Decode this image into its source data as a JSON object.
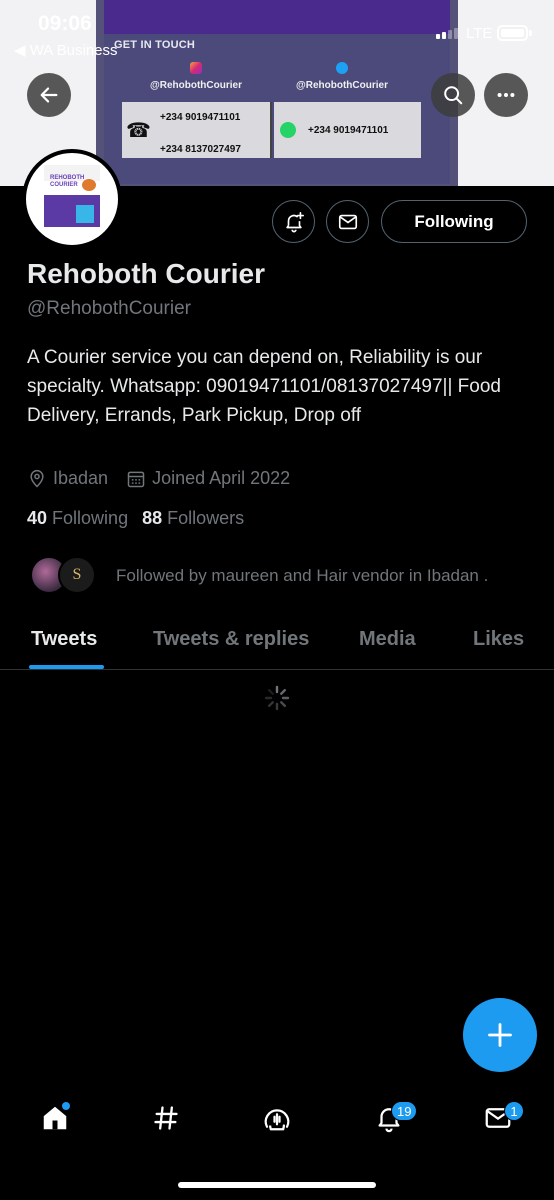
{
  "status_bar": {
    "time": "09:06",
    "back_app": "◀ WA Business",
    "network": "LTE"
  },
  "banner": {
    "heading": "GET IN TOUCH",
    "instagram_handle": "@RehobothCourier",
    "twitter_handle": "@RehobothCourier",
    "phone_1": "+234 9019471101",
    "phone_2": "+234 8137027497",
    "whatsapp_phone": "+234 9019471101"
  },
  "avatar_logo": {
    "title_line1": "REHOBOTH",
    "title_line2": "COURIER"
  },
  "profile": {
    "name": "Rehoboth Courier",
    "handle": "@RehobothCourier",
    "bio": "A Courier service you can depend on, Reliability is our specialty. Whatsapp: 09019471101/08137027497|| Food Delivery, Errands, Park Pickup, Drop off",
    "location": "Ibadan",
    "joined": "Joined April 2022",
    "following_count": "40",
    "following_label": "Following",
    "followers_count": "88",
    "followers_label": "Followers",
    "followed_by": "Followed by maureen and Hair vendor in Ibadan ."
  },
  "actions": {
    "following_button": "Following"
  },
  "tabs": [
    {
      "label": "Tweets",
      "active": true
    },
    {
      "label": "Tweets & replies",
      "active": false
    },
    {
      "label": "Media",
      "active": false
    },
    {
      "label": "Likes",
      "active": false
    }
  ],
  "bottom_nav": {
    "notifications_badge": "19",
    "messages_badge": "1"
  },
  "colors": {
    "accent": "#1d9bf0",
    "background": "#000000",
    "secondary_text": "#71767b"
  }
}
